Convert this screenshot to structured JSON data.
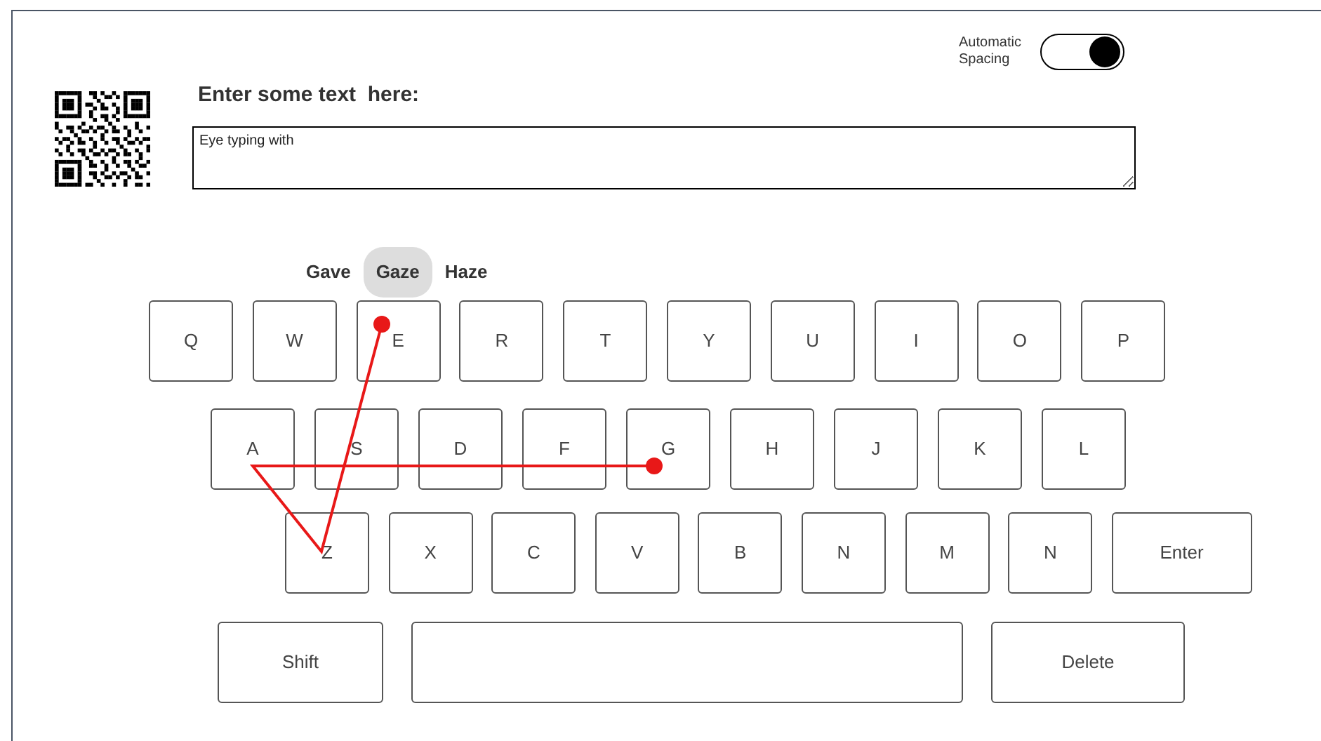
{
  "toggle": {
    "label": "Automatic Spacing",
    "on": true
  },
  "prompt": "Enter some text  here:",
  "text_input": {
    "value": "Eye typing with"
  },
  "suggestions": [
    {
      "label": "Gave",
      "selected": false
    },
    {
      "label": "Gaze",
      "selected": true
    },
    {
      "label": "Haze",
      "selected": false
    }
  ],
  "keyboard": [
    {
      "keys": [
        {
          "kind": "letter",
          "label": "Q"
        },
        {
          "kind": "letter",
          "label": "W"
        },
        {
          "kind": "letter",
          "label": "E"
        },
        {
          "kind": "letter",
          "label": "R"
        },
        {
          "kind": "letter",
          "label": "T"
        },
        {
          "kind": "letter",
          "label": "Y"
        },
        {
          "kind": "letter",
          "label": "U"
        },
        {
          "kind": "letter",
          "label": "I"
        },
        {
          "kind": "letter",
          "label": "O"
        },
        {
          "kind": "letter",
          "label": "P"
        }
      ]
    },
    {
      "keys": [
        {
          "kind": "letter",
          "label": "A"
        },
        {
          "kind": "letter",
          "label": "S"
        },
        {
          "kind": "letter",
          "label": "D"
        },
        {
          "kind": "letter",
          "label": "F"
        },
        {
          "kind": "letter",
          "label": "G"
        },
        {
          "kind": "letter",
          "label": "H"
        },
        {
          "kind": "letter",
          "label": "J"
        },
        {
          "kind": "letter",
          "label": "K"
        },
        {
          "kind": "letter",
          "label": "L"
        }
      ]
    },
    {
      "keys": [
        {
          "kind": "letter",
          "label": "Z"
        },
        {
          "kind": "letter",
          "label": "X"
        },
        {
          "kind": "letter",
          "label": "C"
        },
        {
          "kind": "letter",
          "label": "V"
        },
        {
          "kind": "letter",
          "label": "B"
        },
        {
          "kind": "letter",
          "label": "N"
        },
        {
          "kind": "letter",
          "label": "M"
        },
        {
          "kind": "letter",
          "label": "N"
        },
        {
          "kind": "enter",
          "label": "Enter"
        }
      ]
    },
    {
      "keys": [
        {
          "kind": "shift",
          "label": "Shift"
        },
        {
          "kind": "space"
        },
        {
          "kind": "delete",
          "label": "Delete"
        }
      ]
    }
  ]
}
